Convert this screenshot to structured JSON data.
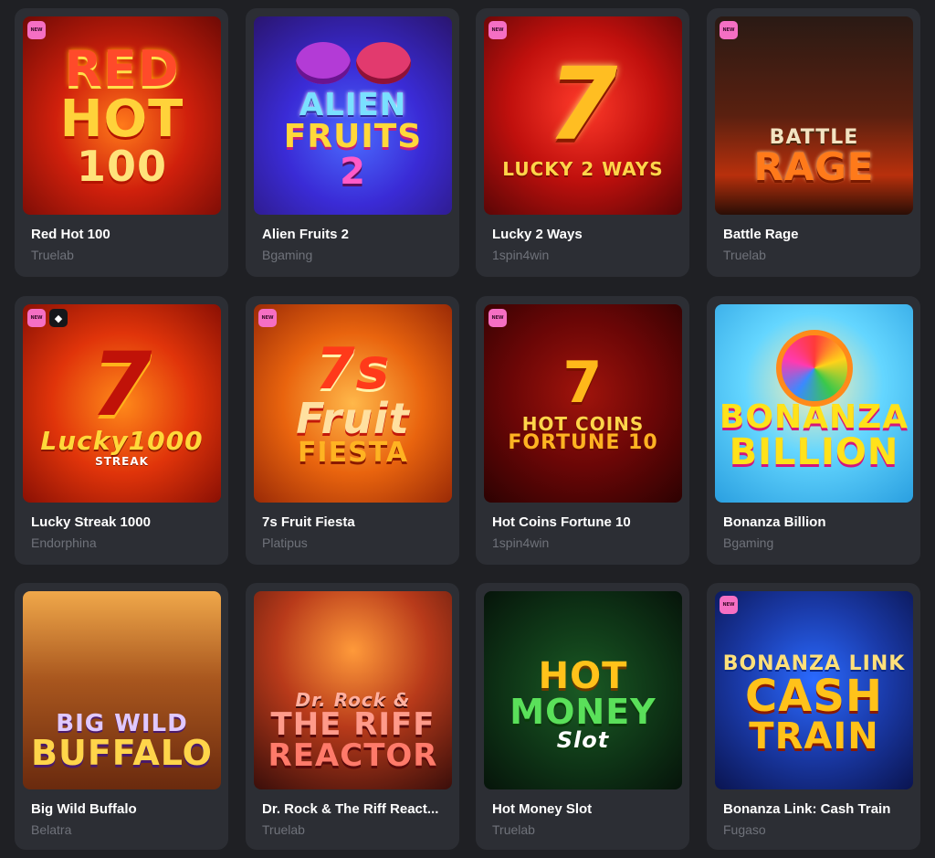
{
  "badges": {
    "new_label": "NEW",
    "diamond_glyph": "◆"
  },
  "colors": {
    "background": "#1f2024",
    "card": "#2c2e34",
    "title": "#ffffff",
    "provider": "#6f727a",
    "new_badge": "#f56fc3"
  },
  "games": [
    {
      "title": "Red Hot 100",
      "provider": "Truelab",
      "is_new": true,
      "art": {
        "l1": "RED",
        "l2": "HOT",
        "l3": "100"
      }
    },
    {
      "title": "Alien Fruits 2",
      "provider": "Bgaming",
      "is_new": false,
      "art": {
        "l1": "ALIEN",
        "l2": "FRUITS",
        "l3": "2"
      }
    },
    {
      "title": "Lucky 2 Ways",
      "provider": "1spin4win",
      "is_new": true,
      "art": {
        "l1": "7",
        "l2": "LUCKY 2 WAYS"
      }
    },
    {
      "title": "Battle Rage",
      "provider": "Truelab",
      "is_new": true,
      "art": {
        "l1": "BATTLE",
        "l2": "RAGE"
      }
    },
    {
      "title": "Lucky Streak 1000",
      "provider": "Endorphina",
      "is_new": true,
      "has_diamond": true,
      "art": {
        "l1": "7",
        "l2": "Lucky1000",
        "l3": "STREAK"
      }
    },
    {
      "title": "7s Fruit Fiesta",
      "provider": "Platipus",
      "is_new": true,
      "art": {
        "l1": "7s",
        "l2": "Fruit",
        "l3": "FIESTA"
      }
    },
    {
      "title": "Hot Coins Fortune 10",
      "provider": "1spin4win",
      "is_new": true,
      "art": {
        "l1": "7",
        "l2": "HOT COINS",
        "l3": "FORTUNE 10"
      }
    },
    {
      "title": "Bonanza Billion",
      "provider": "Bgaming",
      "is_new": false,
      "art": {
        "l1": "BONANZA",
        "l2": "BILLION"
      }
    },
    {
      "title": "Big Wild Buffalo",
      "provider": "Belatra",
      "is_new": false,
      "art": {
        "l1": "BIG WILD",
        "l2": "BUFFALO"
      }
    },
    {
      "title": "Dr. Rock & The Riff React...",
      "provider": "Truelab",
      "is_new": false,
      "art": {
        "l1": "Dr. Rock &",
        "l2": "THE RIFF",
        "l3": "REACTOR"
      }
    },
    {
      "title": "Hot Money Slot",
      "provider": "Truelab",
      "is_new": false,
      "art": {
        "l1": "HOT",
        "l2": "MONEY",
        "l3": "Slot"
      }
    },
    {
      "title": "Bonanza Link: Cash Train",
      "provider": "Fugaso",
      "is_new": true,
      "art": {
        "l1": "BONANZA LINK",
        "l2": "CASH",
        "l3": "TRAIN"
      }
    }
  ]
}
